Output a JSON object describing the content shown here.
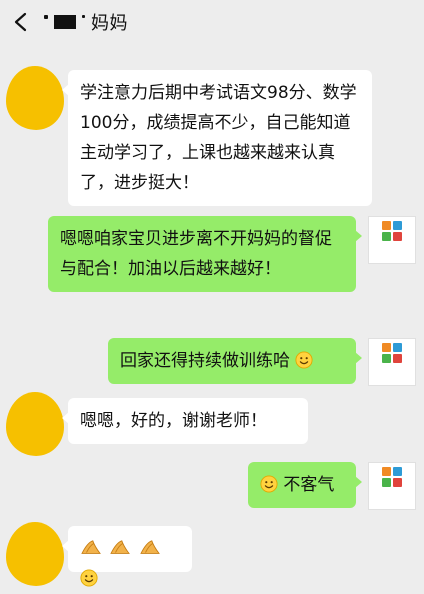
{
  "header": {
    "title": "妈妈",
    "back_icon": "chevron-left-icon"
  },
  "colors": {
    "background": "#ededed",
    "incoming_bubble": "#ffffff",
    "outgoing_bubble": "#95ec69",
    "avatar_yellow": "#f6c000"
  },
  "messages": [
    {
      "direction": "incoming",
      "text": "学注意力后期中考试语文98分、数学100分，成绩提高不少，自己能知道主动学习了，上课也越来越来认真了，进步挺大！"
    },
    {
      "direction": "outgoing",
      "text": "嗯嗯咱家宝贝进步离不开妈妈的督促与配合！加油以后越来越好！"
    },
    {
      "direction": "outgoing",
      "text": "回家还得持续做训练哈",
      "emoji": "smiley-icon"
    },
    {
      "direction": "incoming",
      "text": "嗯嗯，好的，谢谢老师！"
    },
    {
      "direction": "outgoing",
      "text": "不客气",
      "emoji_before": "smiley-icon"
    },
    {
      "direction": "incoming",
      "text": "",
      "emoji": [
        "clap-icon",
        "clap-icon",
        "clap-icon",
        "smiley-icon"
      ]
    }
  ],
  "teacher_avatar": {
    "blocks": [
      "#f08a24",
      "#2e9bd6",
      "#4ab34a",
      "#e0443c"
    ]
  }
}
